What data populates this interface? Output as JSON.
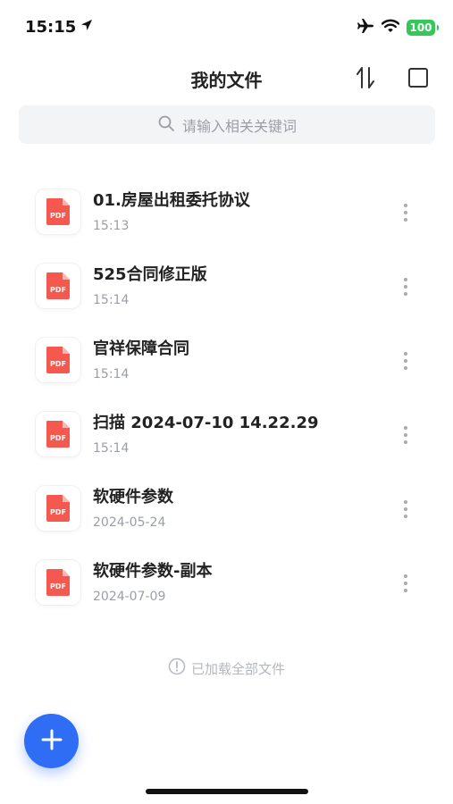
{
  "status_bar": {
    "time": "15:15",
    "battery": "100"
  },
  "header": {
    "title": "我的文件"
  },
  "search": {
    "placeholder": "请输入相关关键词"
  },
  "files": [
    {
      "name": "01.房屋出租委托协议",
      "time": "15:13",
      "type_label": "PDF"
    },
    {
      "name": "525合同修正版",
      "time": "15:14",
      "type_label": "PDF"
    },
    {
      "name": "官祥保障合同",
      "time": "15:14",
      "type_label": "PDF"
    },
    {
      "name": "扫描 2024-07-10 14.22.29",
      "time": "15:14",
      "type_label": "PDF"
    },
    {
      "name": "软硬件参数",
      "time": "2024-05-24",
      "type_label": "PDF"
    },
    {
      "name": "软硬件参数-副本",
      "time": "2024-07-09",
      "type_label": "PDF"
    }
  ],
  "footer": {
    "note": "已加载全部文件"
  },
  "colors": {
    "accent": "#2f6df5",
    "pdf_red": "#f5584e",
    "battery_green": "#34c759"
  },
  "icons": [
    "location-arrow-icon",
    "airplane-icon",
    "wifi-icon",
    "sort-icon",
    "select-icon",
    "search-icon",
    "pdf-icon",
    "more-vertical-icon",
    "info-icon",
    "plus-icon"
  ]
}
